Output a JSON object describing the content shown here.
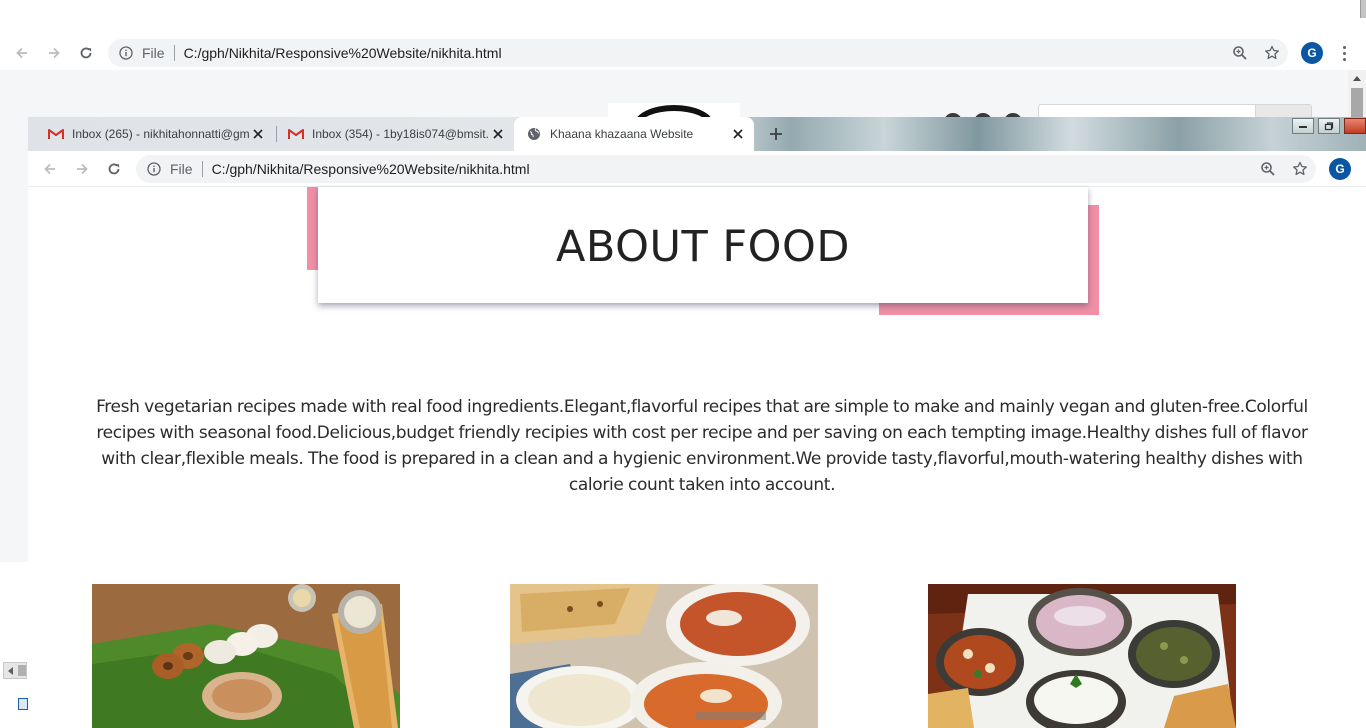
{
  "outer_browser": {
    "url_scheme": "File",
    "url": "C:/gph/Nikhita/Responsive%20Website/nikhita.html",
    "profile_initial": "G"
  },
  "tabs": [
    {
      "title": "Inbox (265) - nikhitahonnatti@gm",
      "icon": "gmail-icon",
      "active": false
    },
    {
      "title": "Inbox (354) - 1by18is074@bmsit.",
      "icon": "gmail-icon",
      "active": false
    },
    {
      "title": "Khaana khazaana Website",
      "icon": "globe-icon",
      "active": true
    }
  ],
  "inner_browser": {
    "url_scheme": "File",
    "url": "C:/gph/Nikhita/Responsive%20Website/nikhita.html",
    "profile_initial": "G"
  },
  "page": {
    "heading": "ABOUT FOOD",
    "about_text": "Fresh vegetarian recipes made with real food ingredients.Elegant,flavorful recipes that are simple to make and mainly vegan and gluten-free.Colorful recipes with seasonal food.Delicious,budget friendly recipies with cost per recipe and per saving on each tempting image.Healthy dishes full of flavor with clear,flexible meals. The food is prepared in a clean and a hygienic environment.We provide tasty,flavorful,mouth-watering healthy dishes with calorie count taken into account.",
    "images": [
      {
        "name": "south-indian-platter-image"
      },
      {
        "name": "naan-curry-rice-image"
      },
      {
        "name": "thali-bowls-image"
      }
    ]
  },
  "colors": {
    "accent_pink": "#f08fa5",
    "avatar_blue": "#0b57a4",
    "omnibox_bg": "#f1f3f4",
    "gmail_red": "#d93025"
  }
}
